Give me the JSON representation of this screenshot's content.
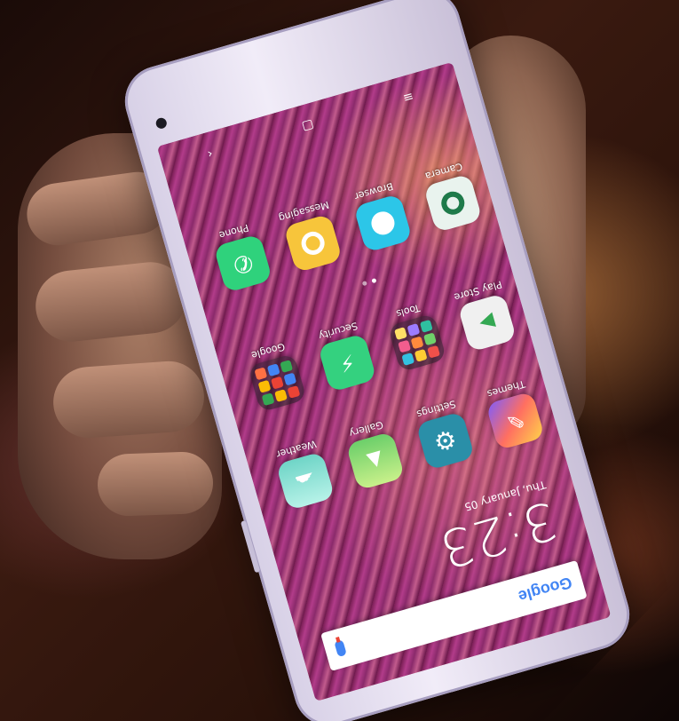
{
  "apps": [
    {
      "label": "Phone",
      "icon": "phone-icon",
      "color": "#2fd27c"
    },
    {
      "label": "Messaging",
      "icon": "messaging-icon",
      "color": "#f7c53b"
    },
    {
      "label": "Browser",
      "icon": "browser-icon",
      "color": "#2cc6e8"
    },
    {
      "label": "Camera",
      "icon": "camera-icon",
      "color": "#e9f3ee"
    },
    {
      "label": "Google",
      "icon": "google-folder-icon",
      "color": "#3a2a3a"
    },
    {
      "label": "Security",
      "icon": "security-icon",
      "color": "#34d17f"
    },
    {
      "label": "Tools",
      "icon": "tools-folder-icon",
      "color": "#3a2a3a"
    },
    {
      "label": "Play Store",
      "icon": "play-store-icon",
      "color": "#f0f0f0"
    },
    {
      "label": "Weather",
      "icon": "weather-icon",
      "color": "#8fe3d6"
    },
    {
      "label": "Gallery",
      "icon": "gallery-icon",
      "color": "#a5e07a"
    },
    {
      "label": "Settings",
      "icon": "settings-icon",
      "color": "#2a8fa8"
    },
    {
      "label": "Themes",
      "icon": "themes-icon",
      "color": "#ff8a5c"
    }
  ],
  "clock": {
    "time": "3:23",
    "date": "Thu, January 05"
  },
  "search": {
    "logo": "Google"
  },
  "nav": {
    "menu": "≡",
    "home": "▢",
    "back": "‹"
  }
}
